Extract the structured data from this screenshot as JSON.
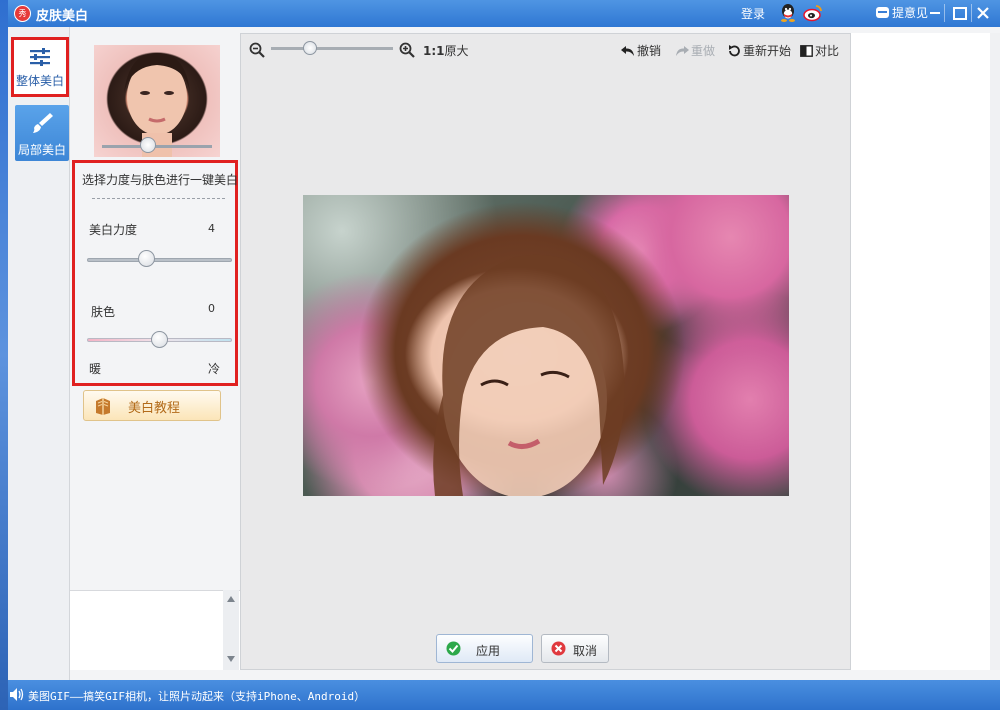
{
  "window": {
    "title": "皮肤美白",
    "login": "登录",
    "feedback": "提意见",
    "logo_text": "秀"
  },
  "modes": [
    {
      "label": "整体美白",
      "icon": "sliders-icon",
      "selected": true
    },
    {
      "label": "局部美白",
      "icon": "brush-icon",
      "selected": false
    }
  ],
  "settings": {
    "preview_slider_level": 0.4,
    "hint": "选择力度与肤色进行一键美白",
    "divider": "--------------------------------",
    "whitening": {
      "label": "美白力度",
      "value": "4",
      "level": 0.4
    },
    "skin": {
      "label": "肤色",
      "value": "0",
      "level": 0.5,
      "left_label": "暖",
      "right_label": "冷"
    },
    "tutorial": "美白教程"
  },
  "canvas_toolbar": {
    "zoom_level": 0.3,
    "actual_size_prefix": "1:1",
    "actual_size_label": "原大",
    "undo": "撤销",
    "redo": "重做",
    "restart": "重新开始",
    "compare": "对比"
  },
  "canvas": {
    "apply": "应用",
    "cancel": "取消"
  },
  "status": {
    "ad_text": "美图GIF——搞笑GIF相机，让照片动起来（支持iPhone、Android）"
  },
  "colors": {
    "title_bar": "#2f77d3",
    "highlight_border": "#e02020",
    "selected_mode": "#3d86d6"
  }
}
